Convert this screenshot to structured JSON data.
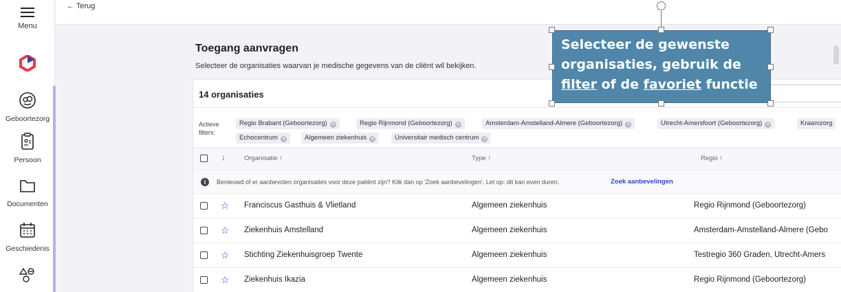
{
  "nav": {
    "menu_label": "Menu",
    "items": [
      {
        "label": "Geboortezorg",
        "icon": "baby-icon"
      },
      {
        "label": "Persoon",
        "icon": "person-card-icon"
      },
      {
        "label": "Documenten",
        "icon": "folder-icon"
      },
      {
        "label": "Geschiedenis",
        "icon": "calendar-icon"
      },
      {
        "label": "",
        "icon": "shapes-icon"
      }
    ]
  },
  "topbar": {
    "back_label": "← Terug"
  },
  "page": {
    "title": "Toegang aanvragen",
    "subtitle": "Selecteer de organisaties waarvan je medische gegevens van de cliënt wil bekijken."
  },
  "results": {
    "count_label": "14 organisaties",
    "filters_label": "Actieve filters:",
    "active_filters": [
      "Regio Brabant (Geboortezorg)",
      "Regio Rijnmond (Geboortezorg)",
      "Amsterdam-Amstelland-Almere (Geboortezorg)",
      "Utrecht-Amersfoort (Geboortezorg)",
      "Kraamzorg",
      "Echocentrum",
      "Algemeen ziekenhuis",
      "Universitair medisch centrum"
    ],
    "columns": {
      "organisatie": "Organisatie ↑",
      "type": "Type ↑",
      "regio": "Regio ↑"
    },
    "info_text": "Benieuwd of er aanbevolen organisaties voor deze patiënt zijn? Klik dan op 'Zoek aanbevelingen'. Let op: dit kan even duren.",
    "info_link": "Zoek aanbevelingen",
    "rows": [
      {
        "organisatie": "Franciscus Gasthuis & Vlietland",
        "type": "Algemeen ziekenhuis",
        "regio": "Regio Rijnmond (Geboortezorg)"
      },
      {
        "organisatie": "Ziekenhuis Amstelland",
        "type": "Algemeen ziekenhuis",
        "regio": "Amsterdam-Amstelland-Almere (Gebo"
      },
      {
        "organisatie": "Stichting Ziekenhuisgroep Twente",
        "type": "Algemeen ziekenhuis",
        "regio": "Testregio 360 Graden, Utrecht-Amers"
      },
      {
        "organisatie": "Ziekenhuis Ikazia",
        "type": "Algemeen ziekenhuis",
        "regio": "Regio Rijnmond (Geboortezorg)"
      }
    ]
  },
  "callout": {
    "line1": "Selecteer de gewenste",
    "line2": "organisaties, gebruik de",
    "word_filter": "filter",
    "word_of_de": " of de ",
    "word_favoriet": "favoriet",
    "word_functie": " functie"
  },
  "colors": {
    "accent": "#2b46c9",
    "callout_bg": "#4f86a9",
    "nav_accent": "#b7b3e0",
    "logo_red": "#e5394a"
  }
}
